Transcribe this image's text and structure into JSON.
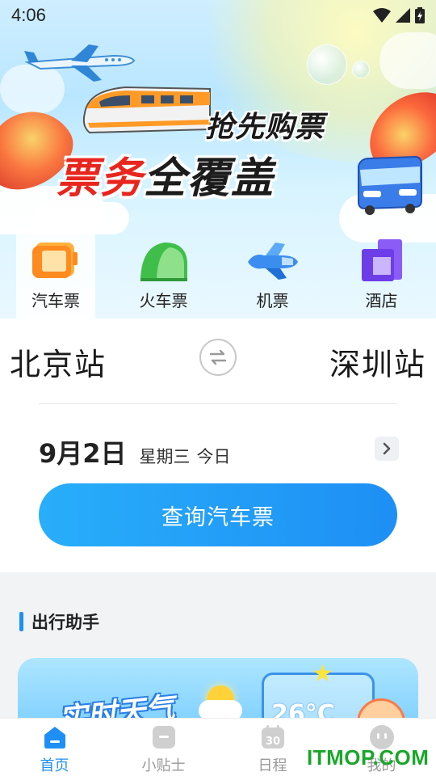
{
  "status_bar": {
    "time": "4:06"
  },
  "banner": {
    "slogan_top": "抢先购票",
    "slogan_main_red_1": "票务",
    "slogan_main_black": "全覆盖",
    "colors": {
      "red": "#e8261e",
      "sky": "#b9e6ff"
    }
  },
  "tabs": [
    {
      "label": "汽车票",
      "icon": "bus-ticket-icon",
      "active": true
    },
    {
      "label": "火车票",
      "icon": "train-icon",
      "active": false
    },
    {
      "label": "机票",
      "icon": "plane-icon",
      "active": false
    },
    {
      "label": "酒店",
      "icon": "hotel-icon",
      "active": false
    }
  ],
  "booking": {
    "from_station": "北京站",
    "to_station": "深圳站",
    "date": "9月2日",
    "weekday": "星期三",
    "today_label": "今日",
    "search_button": "查询汽车票",
    "accent_color": "#1e8ff5"
  },
  "assistant": {
    "section_title": "出行助手",
    "weather_card_title": "实时天气",
    "weather_temp": "26°C"
  },
  "bottom_nav": [
    {
      "label": "首页",
      "icon": "home-icon",
      "active": true
    },
    {
      "label": "小贴士",
      "icon": "tips-icon",
      "active": false
    },
    {
      "label": "日程",
      "icon": "calendar-icon",
      "active": false
    },
    {
      "label": "我的",
      "icon": "profile-icon",
      "active": false
    }
  ],
  "watermark": "ITMOP.COM"
}
